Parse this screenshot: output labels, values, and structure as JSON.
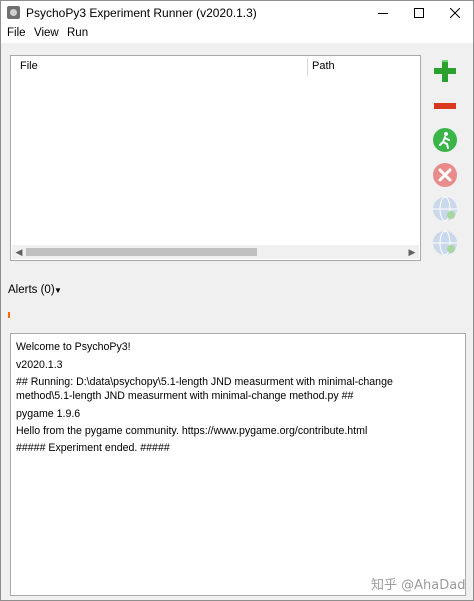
{
  "window": {
    "title": "PsychoPy3 Experiment Runner (v2020.1.3)",
    "minimize_icon": "minimize-icon",
    "maximize_icon": "maximize-icon",
    "close_icon": "close-icon"
  },
  "menu": [
    "File",
    "View",
    "Run"
  ],
  "file_list": {
    "columns": [
      "File",
      "Path"
    ]
  },
  "side_buttons": [
    {
      "name": "add-icon",
      "color": "#2ca02c"
    },
    {
      "name": "remove-icon",
      "color": "#d9381e"
    },
    {
      "name": "run-icon",
      "color": "#3bb54a"
    },
    {
      "name": "stop-icon",
      "color": "#e88b8b"
    },
    {
      "name": "online-icon",
      "color": "#c9d8ea"
    },
    {
      "name": "online-run-icon",
      "color": "#c9d8ea"
    }
  ],
  "alerts": {
    "label": "Alerts (0)"
  },
  "output": {
    "lines": [
      "Welcome to PsychoPy3!",
      "v2020.1.3",
      "## Running: D:\\data\\psychopy\\5.1-length JND measurment with minimal-change",
      "method\\5.1-length JND measurment with minimal-change method.py ##",
      "pygame 1.9.6",
      "Hello from the pygame community. https://www.pygame.org/contribute.html",
      "##### Experiment ended. #####"
    ]
  },
  "watermark": "知乎 @AhaDad"
}
